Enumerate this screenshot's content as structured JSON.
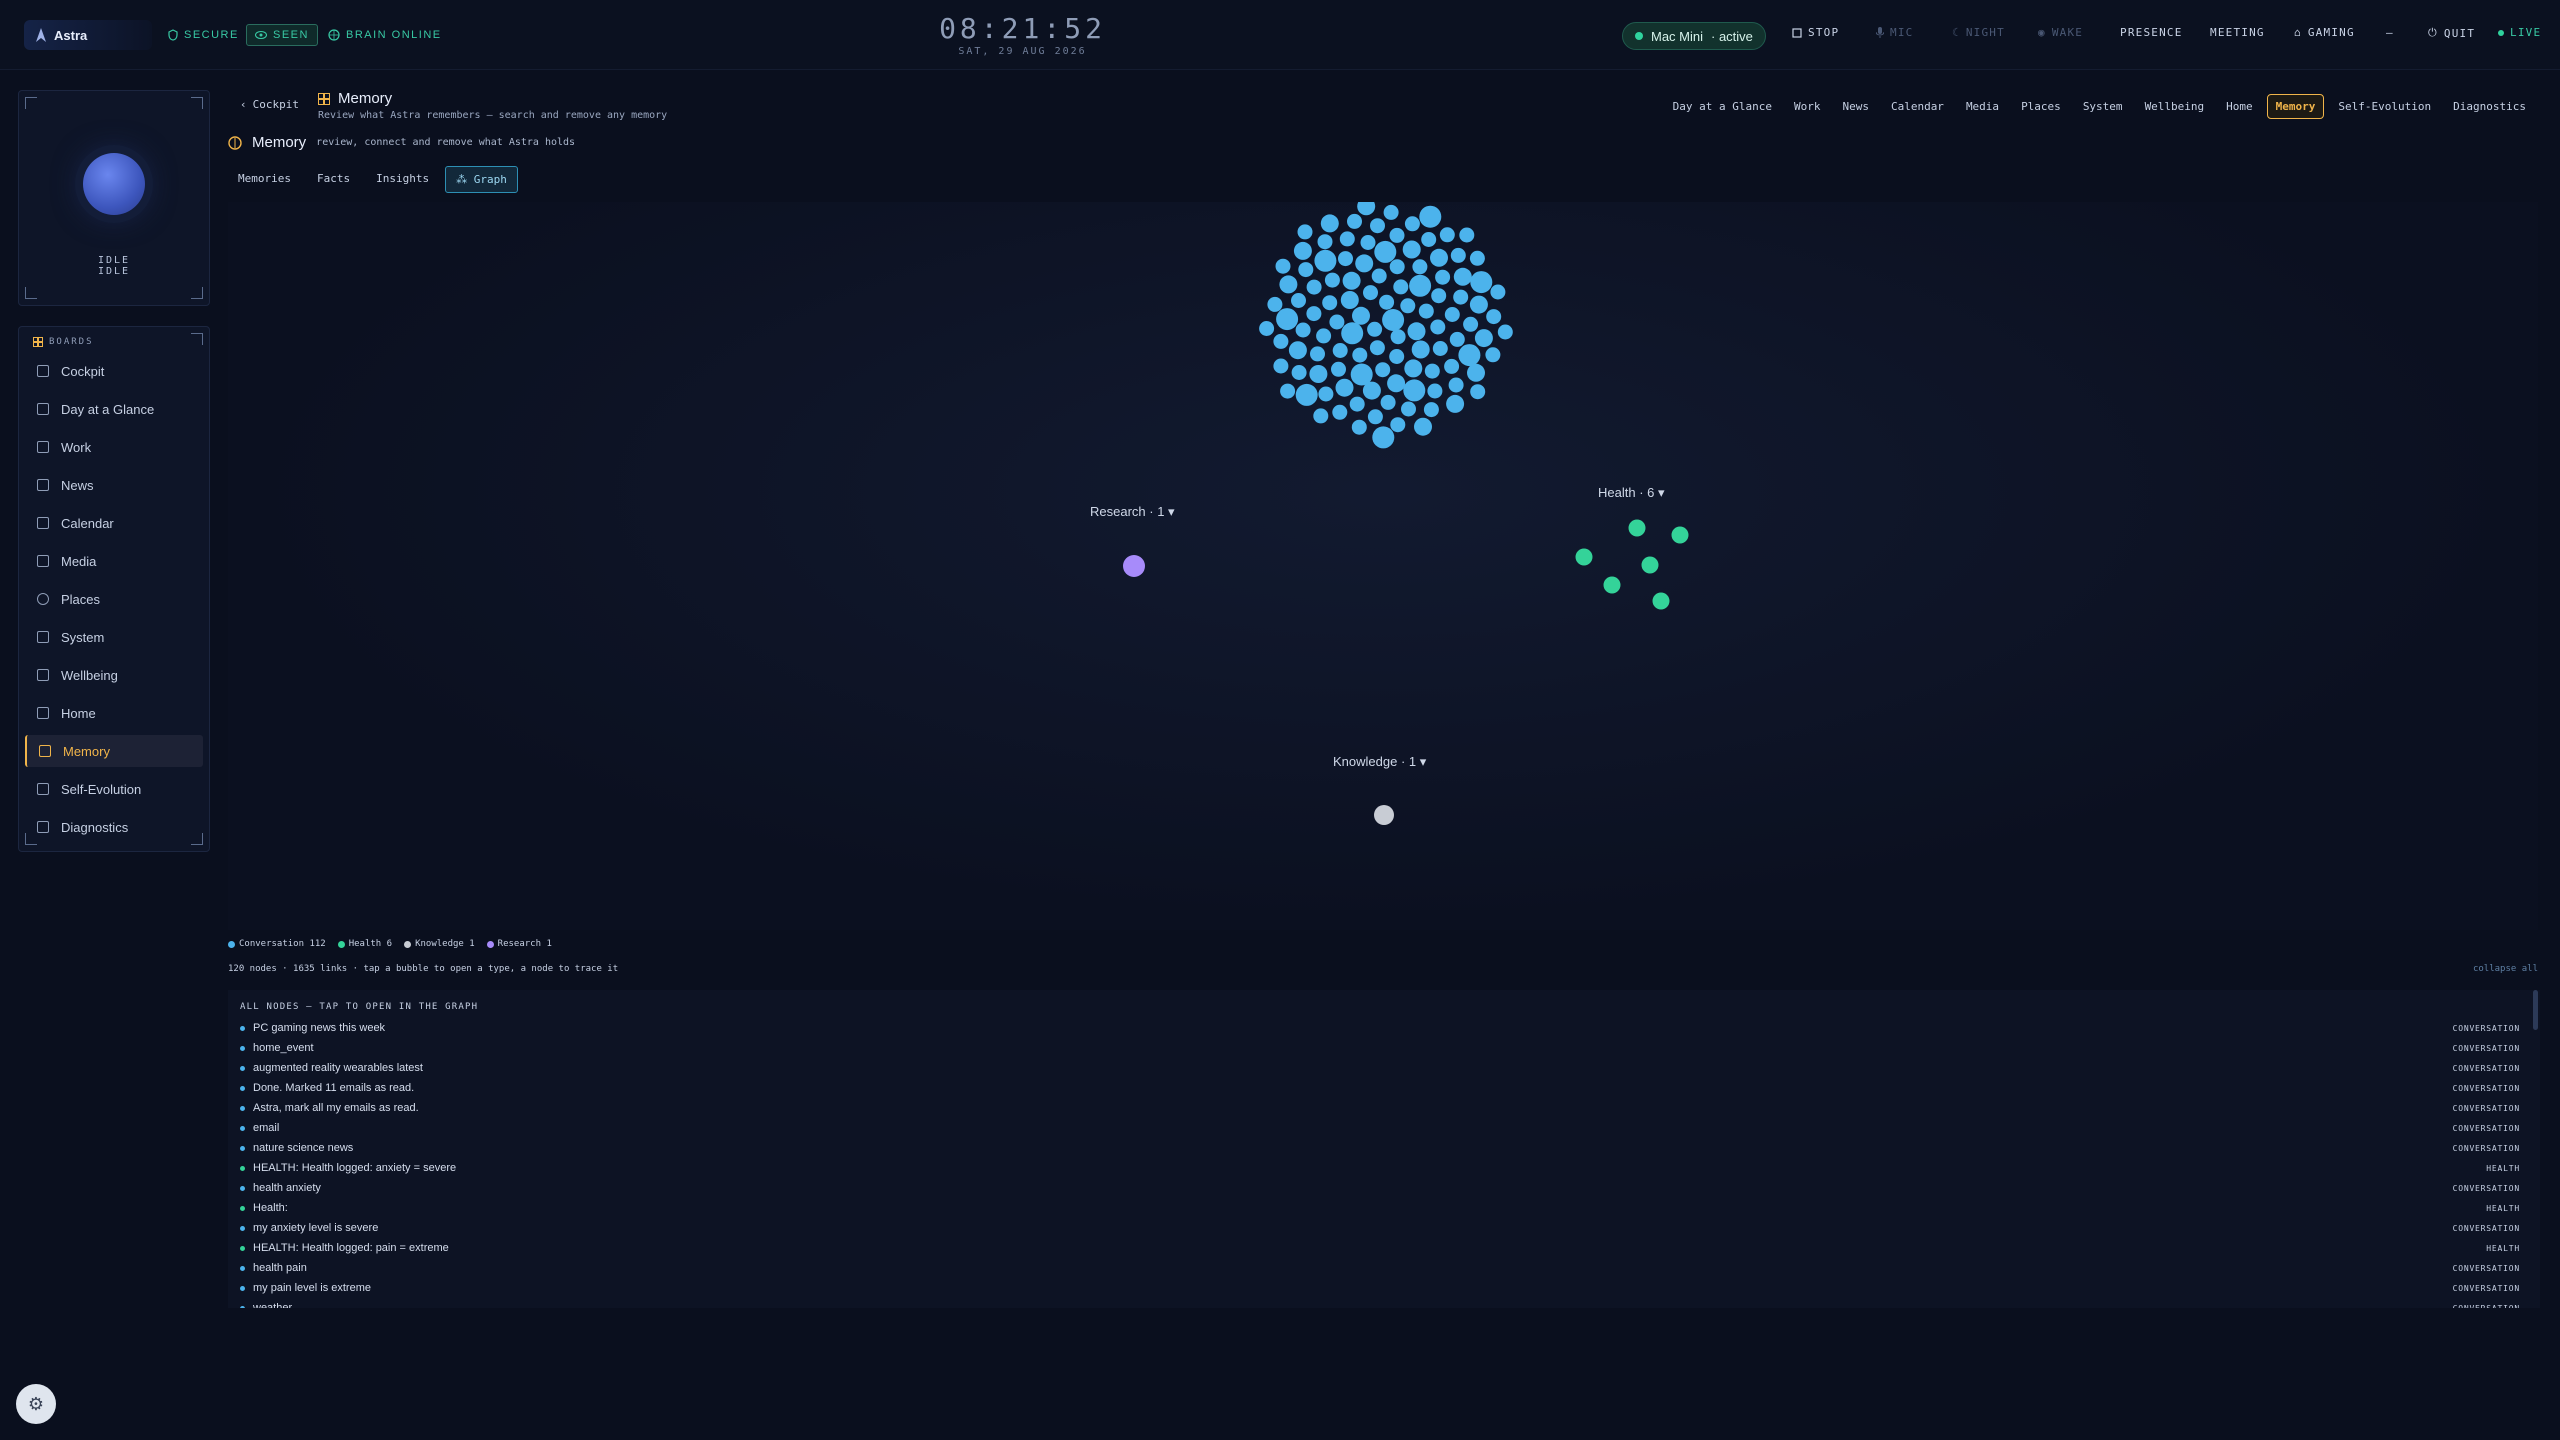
{
  "brand": {
    "name": "Astra"
  },
  "status_pills": [
    {
      "label": "SECURE",
      "icon": "shield-icon"
    },
    {
      "label": "SEEN",
      "icon": "eye-icon"
    },
    {
      "label": "BRAIN ONLINE",
      "icon": "brain-icon"
    }
  ],
  "clock": {
    "time": "08:21:52",
    "date": "SAT, 29 AUG 2026"
  },
  "device": {
    "name": "Mac Mini",
    "status": "· active"
  },
  "top_controls": {
    "stop": "STOP",
    "mic": "MIC",
    "night": "NIGHT",
    "wake": "WAKE",
    "presence": "PRESENCE",
    "meeting": "MEETING",
    "gaming": "GAMING",
    "minimize": "—",
    "quit": "QUIT",
    "live": "LIVE"
  },
  "avatar": {
    "state_line1": "IDLE",
    "state_line2": "IDLE"
  },
  "sidebar": {
    "title": "BOARDS",
    "items": [
      {
        "label": "Cockpit"
      },
      {
        "label": "Day at a Glance"
      },
      {
        "label": "Work"
      },
      {
        "label": "News"
      },
      {
        "label": "Calendar"
      },
      {
        "label": "Media"
      },
      {
        "label": "Places"
      },
      {
        "label": "System"
      },
      {
        "label": "Wellbeing"
      },
      {
        "label": "Home"
      },
      {
        "label": "Memory"
      },
      {
        "label": "Self-Evolution"
      },
      {
        "label": "Diagnostics"
      }
    ],
    "active": "Memory"
  },
  "header": {
    "back_label": "Cockpit",
    "title": "Memory",
    "subtitle": "Review what Astra remembers — search and remove any memory"
  },
  "board_tabs": [
    "Day at a Glance",
    "Work",
    "News",
    "Calendar",
    "Media",
    "Places",
    "System",
    "Wellbeing",
    "Home",
    "Memory",
    "Self-Evolution",
    "Diagnostics"
  ],
  "section": {
    "title": "Memory",
    "subtitle": "review, connect and remove what Astra holds"
  },
  "sub_tabs": [
    "Memories",
    "Facts",
    "Insights",
    "Graph"
  ],
  "graph": {
    "clusters": [
      {
        "label": "Research · 1 ▾",
        "color": "#a78bfa"
      },
      {
        "label": "Health · 6 ▾",
        "color": "#34d399"
      },
      {
        "label": "Knowledge · 1 ▾",
        "color": "#c8ccd4"
      }
    ],
    "conversation_color": "#4cb3ec"
  },
  "legend": [
    {
      "label": "Conversation 112",
      "color": "#4cb3ec"
    },
    {
      "label": "Health 6",
      "color": "#34d399"
    },
    {
      "label": "Knowledge 1",
      "color": "#c8ccd4"
    },
    {
      "label": "Research 1",
      "color": "#a78bfa"
    }
  ],
  "stats": "120 nodes · 1635 links · tap a bubble to open a type, a node to trace it",
  "collapse_label": "collapse all",
  "nodes_list": {
    "title": "ALL NODES — TAP TO OPEN IN THE GRAPH",
    "rows": [
      {
        "text": "PC gaming news this week",
        "kind": "CONVERSATION",
        "color": "#4cb3ec"
      },
      {
        "text": "home_event",
        "kind": "CONVERSATION",
        "color": "#4cb3ec"
      },
      {
        "text": "augmented reality wearables latest",
        "kind": "CONVERSATION",
        "color": "#4cb3ec"
      },
      {
        "text": "Done. Marked 11 emails as read.",
        "kind": "CONVERSATION",
        "color": "#4cb3ec"
      },
      {
        "text": "Astra, mark all my emails as read.",
        "kind": "CONVERSATION",
        "color": "#4cb3ec"
      },
      {
        "text": "email",
        "kind": "CONVERSATION",
        "color": "#4cb3ec"
      },
      {
        "text": "nature science news",
        "kind": "CONVERSATION",
        "color": "#4cb3ec"
      },
      {
        "text": "HEALTH: Health logged: anxiety = severe",
        "kind": "HEALTH",
        "color": "#34d399"
      },
      {
        "text": "health anxiety",
        "kind": "CONVERSATION",
        "color": "#4cb3ec"
      },
      {
        "text": "Health:",
        "kind": "HEALTH",
        "color": "#34d399"
      },
      {
        "text": "my anxiety level is severe",
        "kind": "CONVERSATION",
        "color": "#4cb3ec"
      },
      {
        "text": "HEALTH: Health logged: pain = extreme",
        "kind": "HEALTH",
        "color": "#34d399"
      },
      {
        "text": "health pain",
        "kind": "CONVERSATION",
        "color": "#4cb3ec"
      },
      {
        "text": "my pain level is extreme",
        "kind": "CONVERSATION",
        "color": "#4cb3ec"
      },
      {
        "text": "weather",
        "kind": "CONVERSATION",
        "color": "#4cb3ec"
      }
    ]
  }
}
